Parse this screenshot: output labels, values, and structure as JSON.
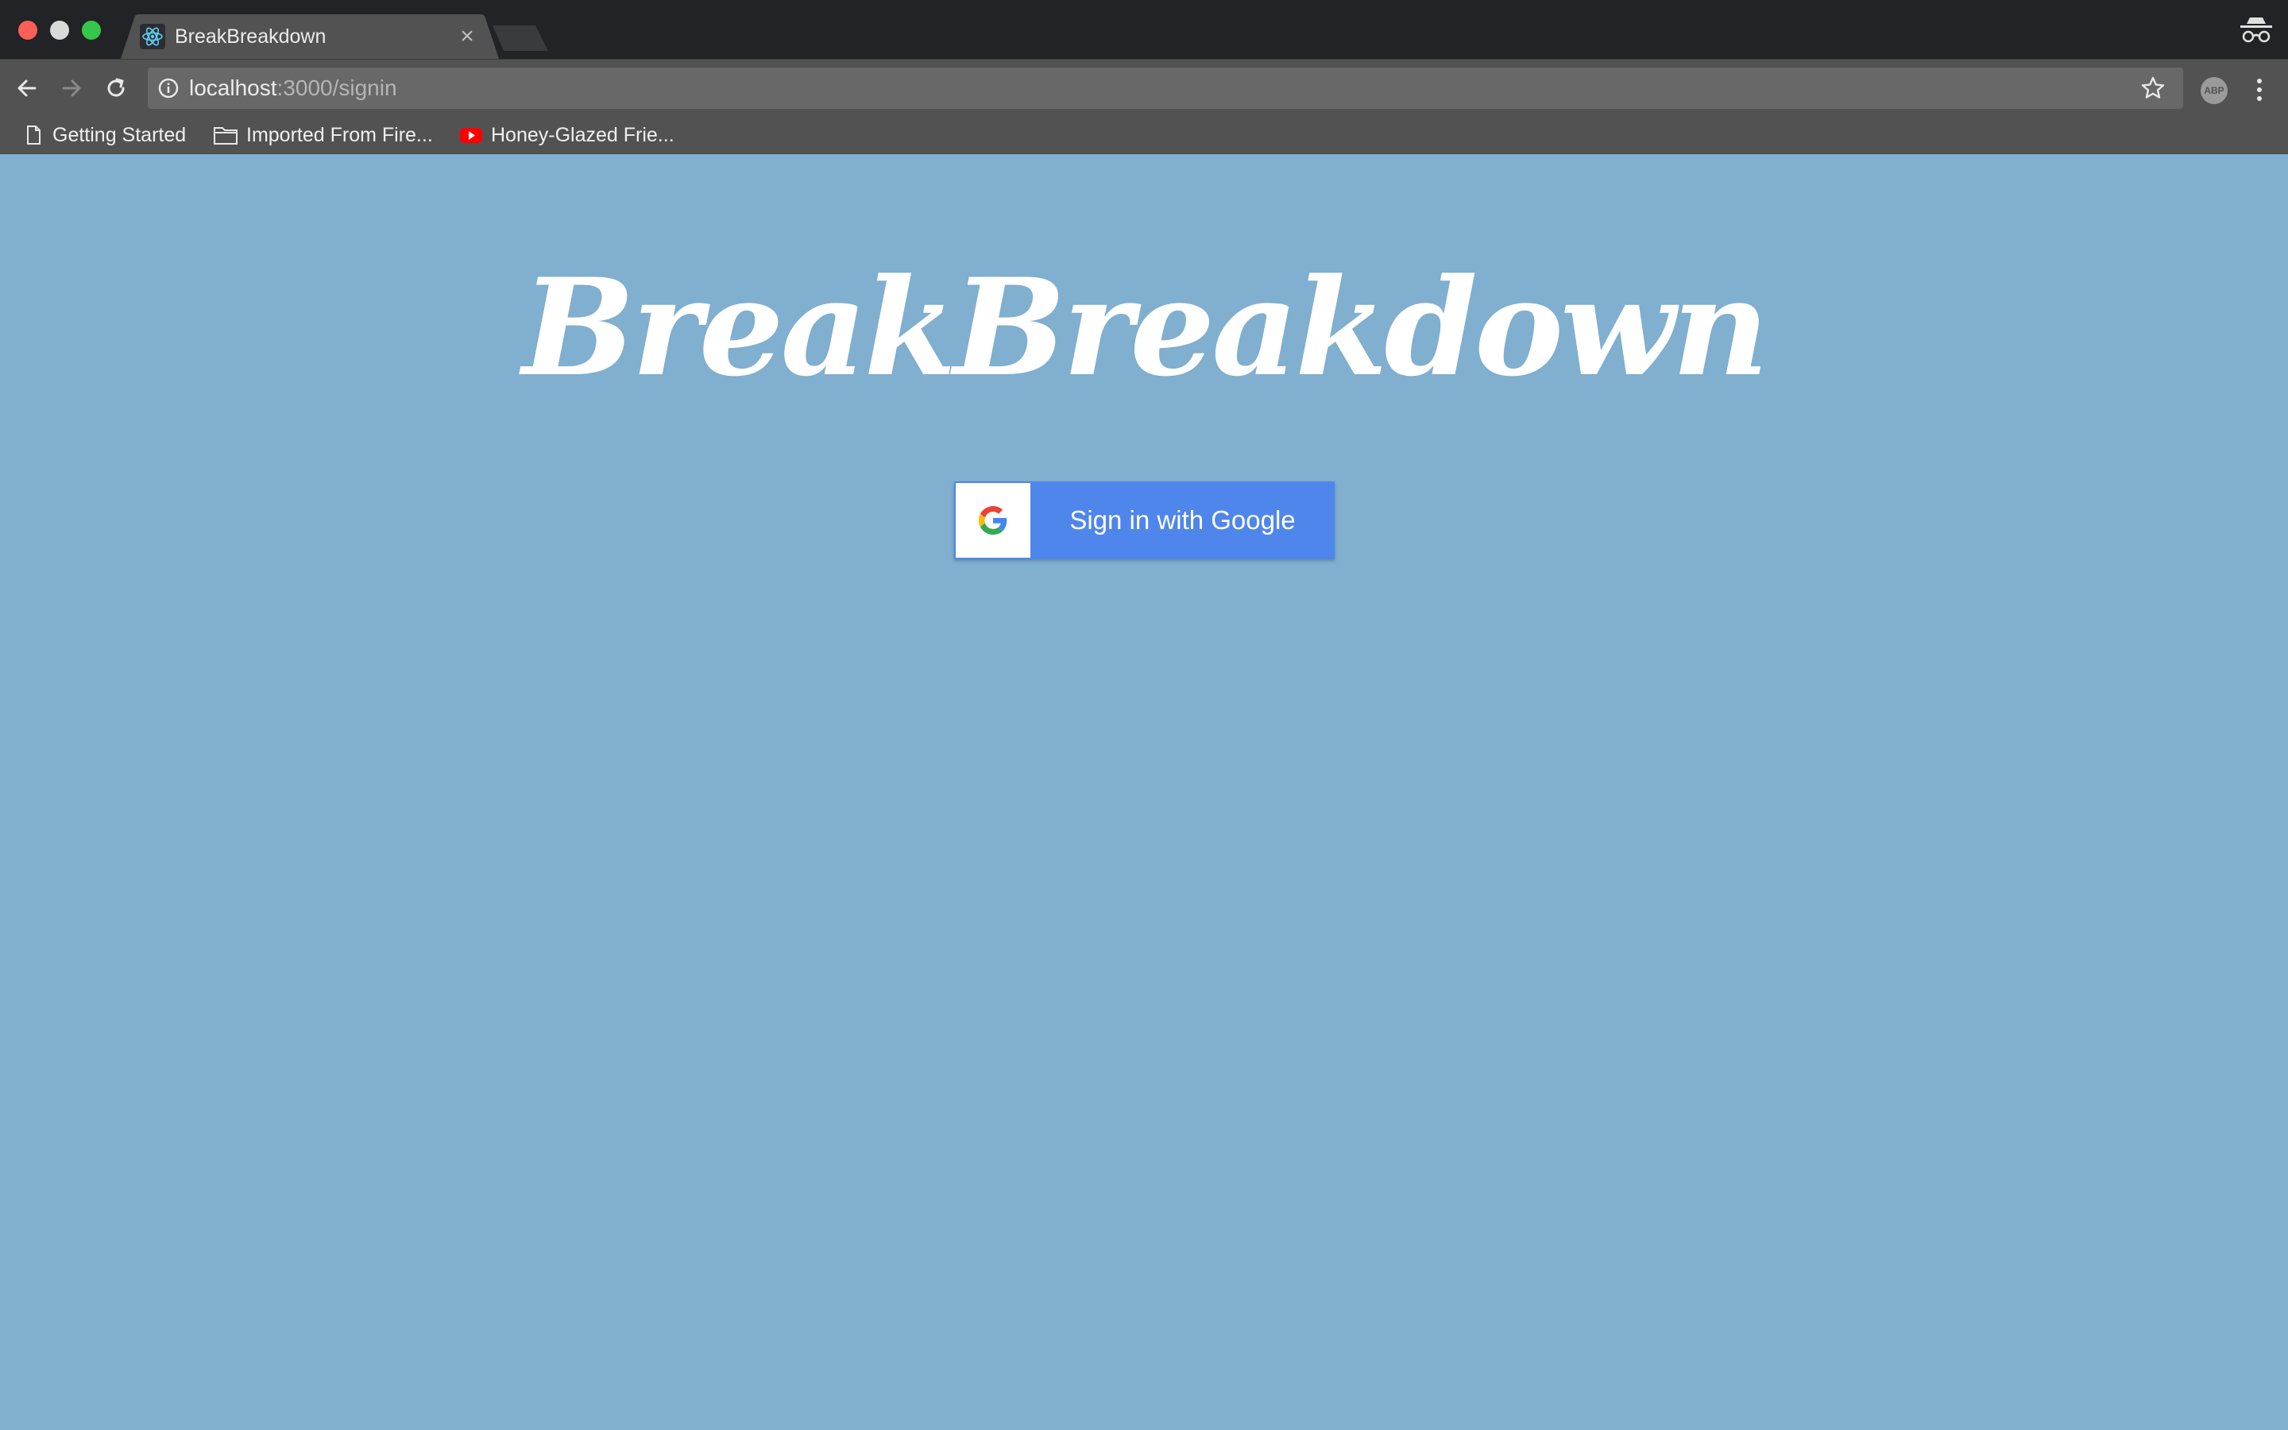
{
  "browser": {
    "tab": {
      "title": "BreakBreakdown",
      "close_glyph": "×",
      "favicon": "react-logo-icon"
    },
    "address_bar": {
      "host": "localhost",
      "path": ":3000/signin"
    },
    "bookmarks": [
      {
        "label": "Getting Started",
        "icon": "page-icon"
      },
      {
        "label": "Imported From Fire...",
        "icon": "folder-icon"
      },
      {
        "label": "Honey-Glazed Frie...",
        "icon": "youtube-icon"
      }
    ],
    "extension": {
      "label": "ABP"
    }
  },
  "page": {
    "brand_title": "BreakBreakdown",
    "google_button": {
      "label": "Sign in with Google"
    }
  },
  "colors": {
    "page_background": "#80afcf",
    "google_button": "#4f86ec",
    "titlebar": "#222326",
    "toolbar": "#525252"
  }
}
